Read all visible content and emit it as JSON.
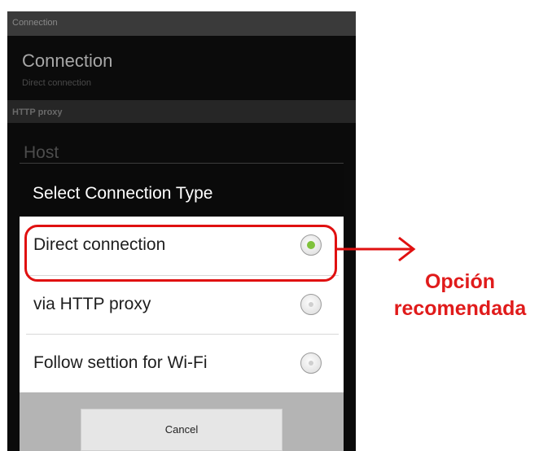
{
  "statusbar": {
    "title": "Connection"
  },
  "preference": {
    "title": "Connection",
    "summary": "Direct connection"
  },
  "section": {
    "header": "HTTP proxy"
  },
  "host": {
    "label": "Host"
  },
  "dialog": {
    "title": "Select Connection Type",
    "options": [
      {
        "label": "Direct connection",
        "selected": true
      },
      {
        "label": "via HTTP proxy",
        "selected": false
      },
      {
        "label": "Follow settion for Wi-Fi",
        "selected": false
      }
    ],
    "cancel_label": "Cancel"
  },
  "annotation": {
    "line1": "Opción",
    "line2": "recomendada",
    "color": "#e01b1b"
  },
  "colors": {
    "accent_green": "#7fc23b",
    "highlight_red": "#e01010"
  }
}
